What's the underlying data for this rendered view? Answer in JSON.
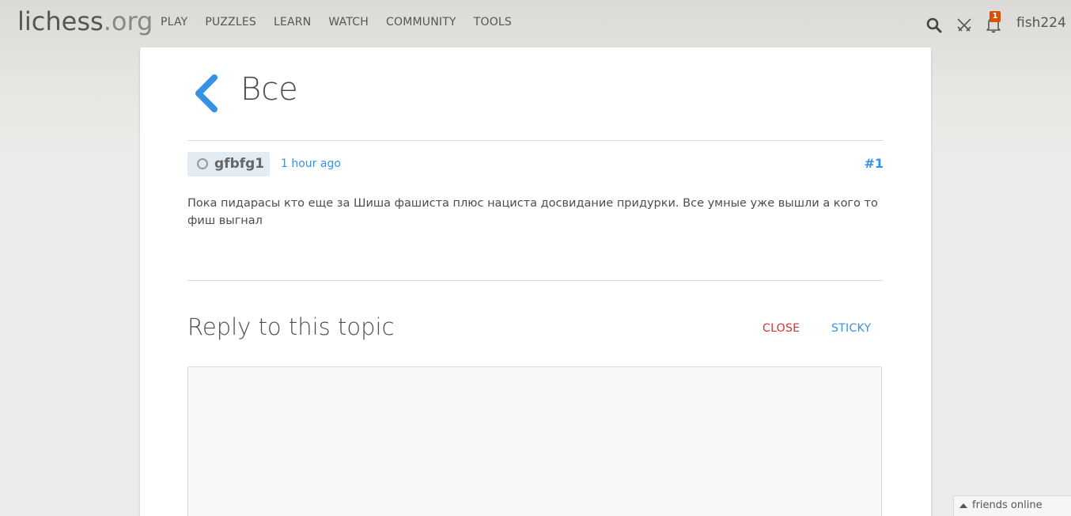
{
  "header": {
    "logo_main": "lichess",
    "logo_tld": ".org",
    "nav": [
      "PLAY",
      "PUZZLES",
      "LEARN",
      "WATCH",
      "COMMUNITY",
      "TOOLS"
    ],
    "notification_count": "1",
    "username": "fish224",
    "icons": [
      "search-icon",
      "swords-icon",
      "bell-icon"
    ]
  },
  "topic": {
    "title": "Все",
    "back_icon": "chevron-left-icon"
  },
  "post": {
    "author": "gfbfg1",
    "time": "1 hour ago",
    "number": "#1",
    "text": "Пока пидарасы кто еще за Шиша фашиста плюс нациста досвидание придурки. Все умные уже вышли а кого то фиш выгнал"
  },
  "reply": {
    "title": "Reply to this topic",
    "close_label": "CLOSE",
    "sticky_label": "STICKY",
    "textarea_value": ""
  },
  "friends": {
    "label": "friends online"
  },
  "colors": {
    "link": "#3692e7",
    "danger": "#cc3333",
    "badge": "#d85000",
    "chip_bg": "#e3ebf3"
  }
}
